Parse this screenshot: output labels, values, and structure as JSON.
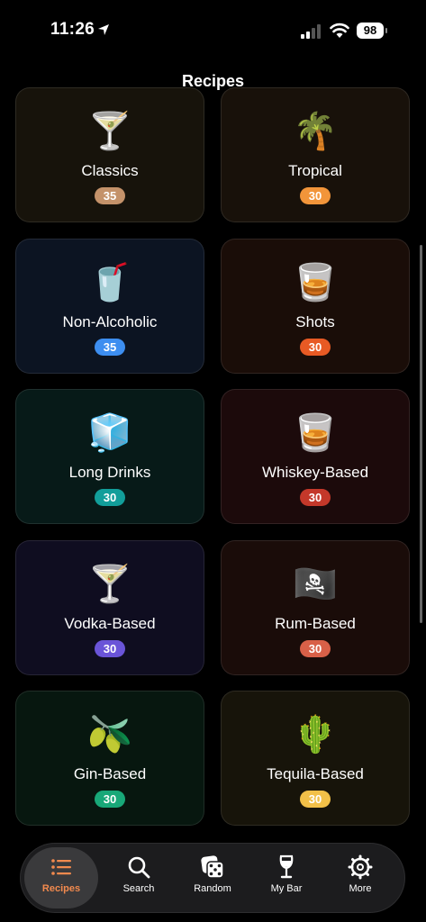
{
  "status_bar": {
    "time": "11:26",
    "battery": "98"
  },
  "nav": {
    "title": "Recipes"
  },
  "categories": [
    {
      "label": "Classics",
      "count": "35",
      "emoji": "🍸",
      "badge_color": "#c4926a",
      "bg": "#17130b"
    },
    {
      "label": "Tropical",
      "count": "30",
      "emoji": "🌴",
      "badge_color": "#f2953a",
      "bg": "#18110a"
    },
    {
      "label": "Non-Alcoholic",
      "count": "35",
      "emoji": "🥤",
      "badge_color": "#3d8ef0",
      "bg": "#0c1422"
    },
    {
      "label": "Shots",
      "count": "30",
      "emoji": "🥃",
      "badge_color": "#e85a24",
      "bg": "#1a0d08"
    },
    {
      "label": "Long Drinks",
      "count": "30",
      "emoji": "🧊",
      "badge_color": "#129e9a",
      "bg": "#071a18"
    },
    {
      "label": "Whiskey-Based",
      "count": "30",
      "emoji": "🥃",
      "badge_color": "#c4382a",
      "bg": "#1c0a0b"
    },
    {
      "label": "Vodka-Based",
      "count": "30",
      "emoji": "🍸",
      "badge_color": "#6a54d8",
      "bg": "#0f0d20"
    },
    {
      "label": "Rum-Based",
      "count": "30",
      "emoji": "🏴‍☠️",
      "badge_color": "#d86048",
      "bg": "#1a0c09"
    },
    {
      "label": "Gin-Based",
      "count": "30",
      "emoji": "🫒",
      "badge_color": "#18a878",
      "bg": "#07170f"
    },
    {
      "label": "Tequila-Based",
      "count": "30",
      "emoji": "🌵",
      "badge_color": "#f2c048",
      "bg": "#17140a"
    }
  ],
  "tabs": [
    {
      "label": "Recipes",
      "icon": "list-icon",
      "active": true
    },
    {
      "label": "Search",
      "icon": "search-icon",
      "active": false
    },
    {
      "label": "Random",
      "icon": "dice-icon",
      "active": false
    },
    {
      "label": "My Bar",
      "icon": "wine-glass-icon",
      "active": false
    },
    {
      "label": "More",
      "icon": "gear-icon",
      "active": false
    }
  ],
  "colors": {
    "accent": "#f28a4e",
    "tab_bar_bg": "#1c1c1e"
  }
}
